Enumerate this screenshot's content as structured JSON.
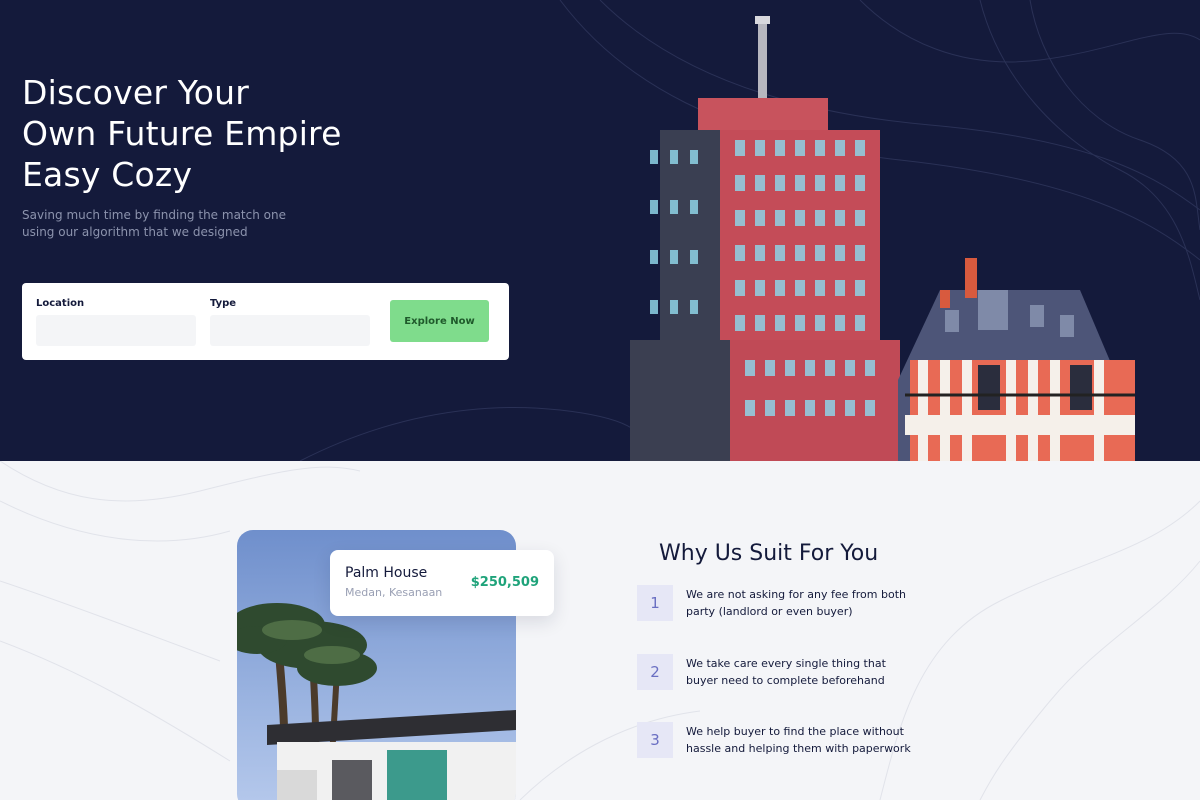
{
  "hero": {
    "title_line1": "Discover Your",
    "title_line2": "Own Future Empire",
    "title_line3": "Easy Cozy",
    "subtitle_line1": "Saving much time by finding the match one",
    "subtitle_line2": "using our algorithm that we designed"
  },
  "search": {
    "location_label": "Location",
    "location_value": "",
    "type_label": "Type",
    "type_value": "",
    "button_label": "Explore Now"
  },
  "listing": {
    "name": "Palm House",
    "location": "Medan, Kesanaan",
    "price": "$250,509"
  },
  "why": {
    "title": "Why Us Suit For You",
    "items": [
      {
        "number": "1",
        "text": "We are not asking for any fee from both party (landlord or even buyer)"
      },
      {
        "number": "2",
        "text": "We take care every single thing that buyer need to complete beforehand"
      },
      {
        "number": "3",
        "text": "We help buyer to find the place without hassle and helping them with paperwork"
      }
    ]
  },
  "colors": {
    "hero_bg": "#141a3b",
    "accent_green": "#7fdc8c",
    "price_green": "#1fa37a",
    "badge_bg": "#e6e7f6",
    "badge_text": "#6a6fc2"
  }
}
